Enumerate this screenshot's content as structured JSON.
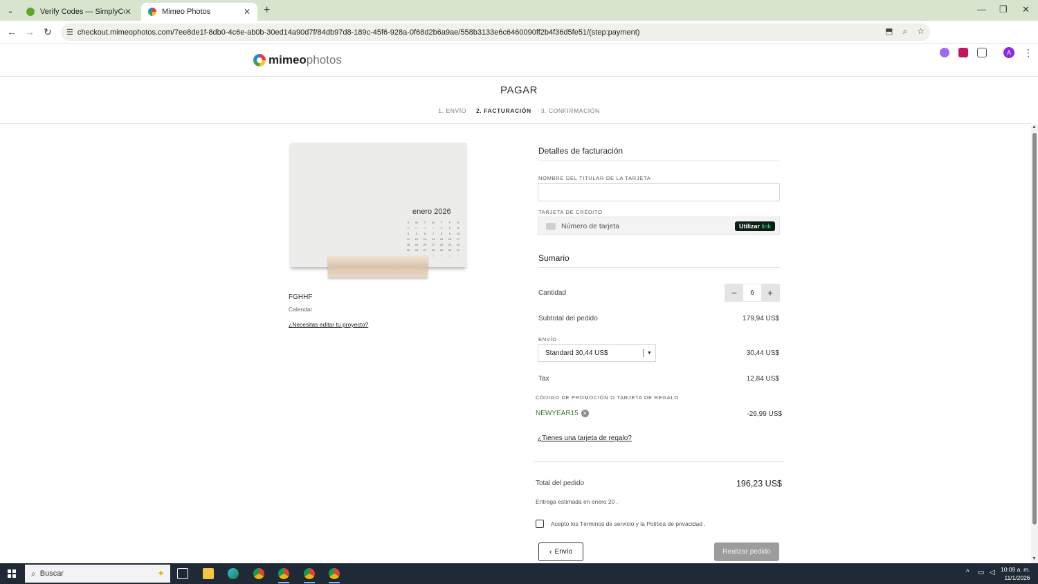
{
  "browser": {
    "tabs": [
      {
        "title": "Verify Codes — SimplyCodes",
        "active": false,
        "color": "#5aa82a"
      },
      {
        "title": "Mimeo Photos",
        "active": true,
        "color": "#e53935"
      }
    ],
    "url": "checkout.mimeophotos.com/7ee8de1f-8db0-4c6e-ab0b-30ed14a90d7f/84db97d8-189c-45f6-928a-0f68d2b6a9ae/558b3133e6c6460090ff2b4f36d5fe51/(step:payment)",
    "avatar_letter": "A"
  },
  "site": {
    "logo_bold": "mimeo",
    "logo_light": "photos"
  },
  "checkout": {
    "title": "PAGAR",
    "steps": [
      "1. ENVÍO",
      "2. FACTURACIÓN",
      "3. CONFIRMACIÓN"
    ],
    "current_step": 2
  },
  "product": {
    "month_label": "enero 2026",
    "calendar_heads": [
      "S",
      "M",
      "T",
      "W",
      "T",
      "F",
      "S"
    ],
    "calendar_days": [
      "28",
      "29",
      "30",
      "31",
      "1",
      "2",
      "3",
      "4",
      "5",
      "6",
      "7",
      "8",
      "9",
      "10",
      "11",
      "12",
      "13",
      "14",
      "15",
      "16",
      "17",
      "18",
      "19",
      "20",
      "21",
      "22",
      "23",
      "24",
      "25",
      "26",
      "27",
      "28",
      "29",
      "30",
      "31",
      "1",
      "2",
      "3",
      "4",
      "5",
      "6",
      "7"
    ],
    "name": "FGHHF",
    "type": "Calendar",
    "edit_link": "¿Necesitas editar tu proyecto?"
  },
  "billing": {
    "title": "Detalles de facturación",
    "cardholder_label": "NOMBRE DEL TITULAR DE LA TARJETA",
    "cardholder_value": "",
    "card_label": "TARJETA DE CRÉDITO",
    "card_placeholder": "Número de tarjeta",
    "link_prefix": "Utilizar",
    "link_brand": "link"
  },
  "summary": {
    "title": "Sumario",
    "quantity_label": "Cantidad",
    "quantity": "6",
    "minus": "−",
    "plus": "+",
    "subtotal_label": "Subtotal del pedido",
    "subtotal": "179,94 US$",
    "shipping_label": "ENVÍO",
    "shipping_option": "Standard 30,44 US$",
    "shipping_value": "30,44 US$",
    "tax_label": "Tax",
    "tax": "12,84 US$",
    "promo_label": "CÓDIGO DE PROMOCIÓN O TARJETA DE REGALO",
    "promo_code": "NEWYEAR15",
    "promo_value": "-26,99 US$",
    "gift_link": "¿Tienes una tarjeta de regalo?",
    "total_label": "Total del pedido",
    "total": "196,23 US$",
    "delivery": "Entrega estimada en enero 20 .",
    "terms": "Acepto los Términos de servicio y la Política de privacidad .",
    "back_label": "Envío",
    "order_label": "Realizar pedido"
  },
  "taskbar": {
    "search_placeholder": "Buscar",
    "time": "10:09 a. m.",
    "date": "11/1/2026"
  }
}
